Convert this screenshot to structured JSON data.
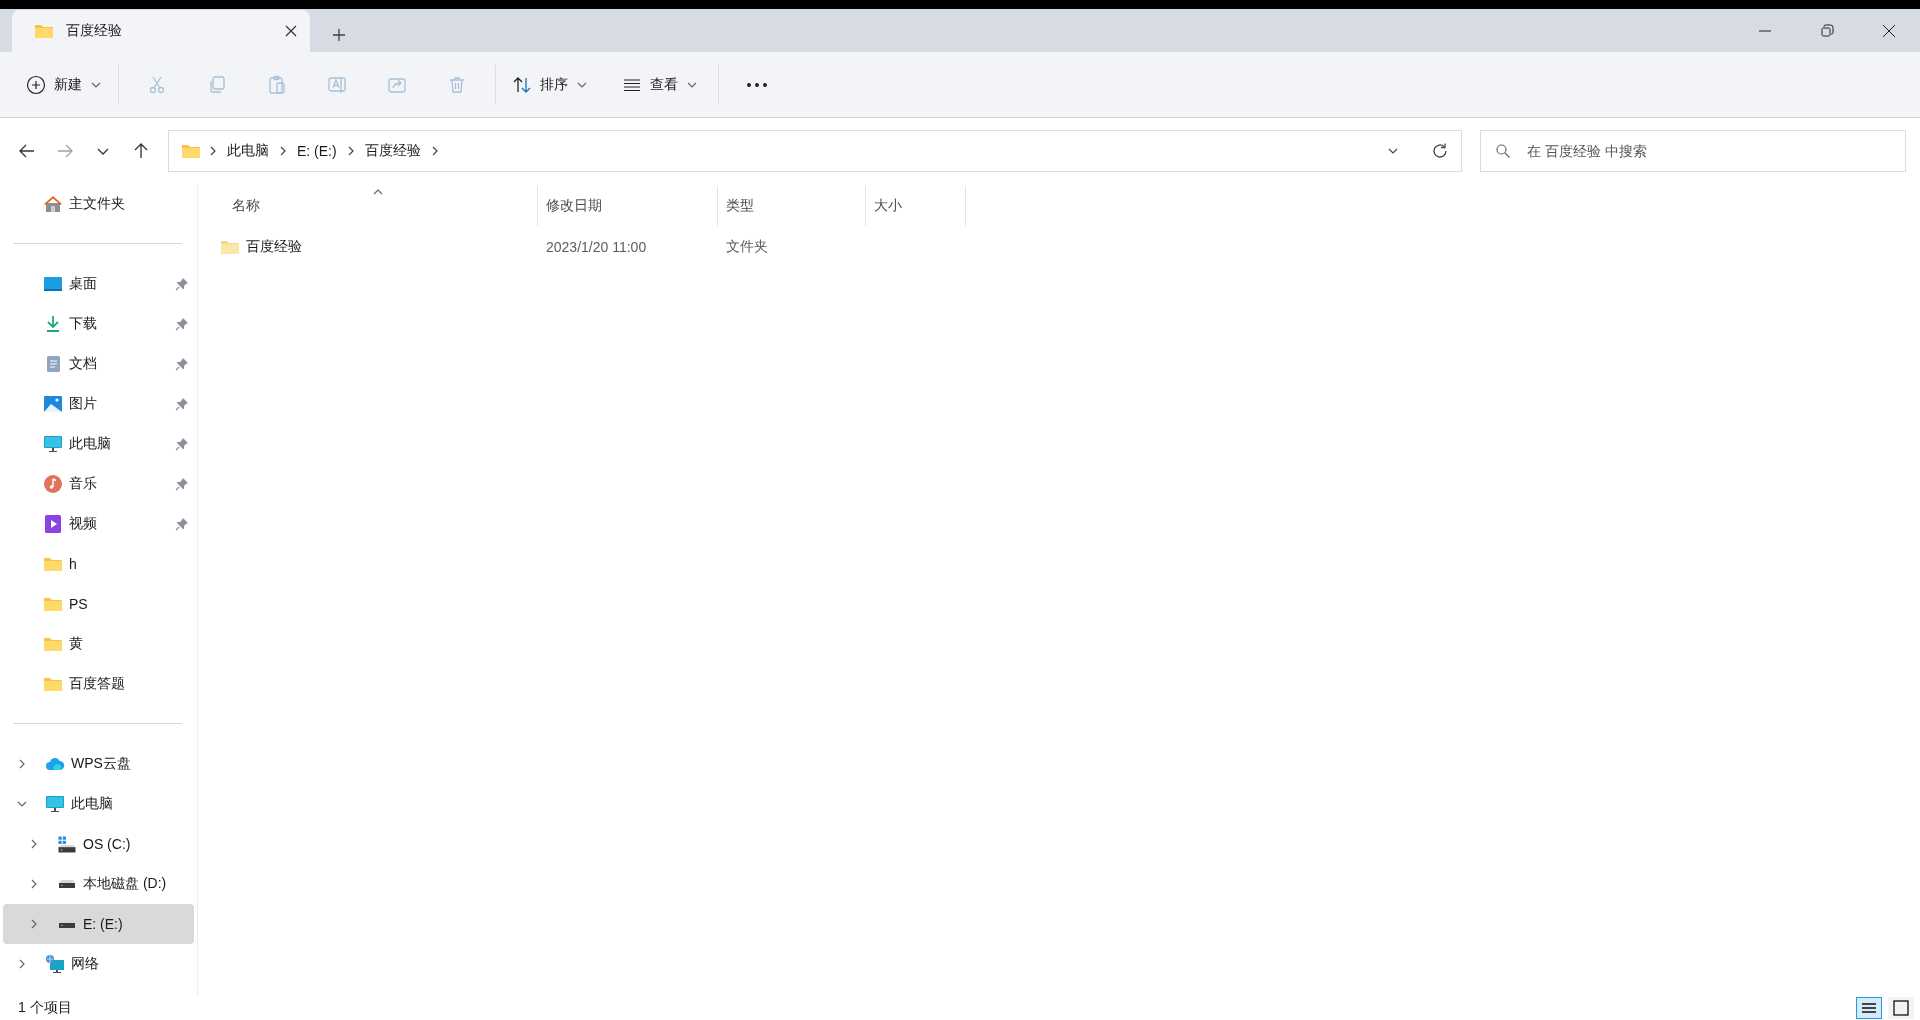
{
  "window": {
    "tabs": [
      {
        "title": "百度经验",
        "selected": true
      }
    ]
  },
  "toolbar": {
    "new_label": "新建",
    "actions": [
      {
        "kind": "cut",
        "disabled": true
      },
      {
        "kind": "copy",
        "disabled": true
      },
      {
        "kind": "paste",
        "disabled": true
      },
      {
        "kind": "rename",
        "disabled": true
      },
      {
        "kind": "share",
        "disabled": true
      },
      {
        "kind": "delete",
        "disabled": true
      }
    ],
    "sort_label": "排序",
    "view_label": "查看"
  },
  "navigation": {
    "buttons": [
      {
        "kind": "back",
        "disabled": false
      },
      {
        "kind": "forward",
        "disabled": true
      },
      {
        "kind": "recent",
        "disabled": false
      },
      {
        "kind": "up",
        "disabled": false
      }
    ],
    "breadcrumb": [
      "此电脑",
      "E: (E:)",
      "百度经验"
    ],
    "search": {
      "placeholder": "在 百度经验 中搜索"
    }
  },
  "sidebar": {
    "home": {
      "label": "主文件夹",
      "kind": "home"
    },
    "quick_access": [
      {
        "label": "桌面",
        "kind": "desktop",
        "pinned": true
      },
      {
        "label": "下载",
        "kind": "download",
        "pinned": true
      },
      {
        "label": "文档",
        "kind": "documents",
        "pinned": true
      },
      {
        "label": "图片",
        "kind": "pictures",
        "pinned": true
      },
      {
        "label": "此电脑",
        "kind": "pc",
        "pinned": true
      },
      {
        "label": "音乐",
        "kind": "music",
        "pinned": true
      },
      {
        "label": "视频",
        "kind": "video",
        "pinned": true
      },
      {
        "label": "h",
        "kind": "folder",
        "pinned": false
      },
      {
        "label": "PS",
        "kind": "folder",
        "pinned": false
      },
      {
        "label": "黄",
        "kind": "folder",
        "pinned": false
      },
      {
        "label": "百度答题",
        "kind": "folder",
        "pinned": false
      }
    ],
    "tree": [
      {
        "label": "WPS云盘",
        "kind": "cloud",
        "expanded": false,
        "selected": false
      },
      {
        "label": "此电脑",
        "kind": "pc",
        "expanded": true,
        "selected": false,
        "children": [
          {
            "label": "OS (C:)",
            "kind": "os-drive",
            "expanded": false,
            "selected": false
          },
          {
            "label": "本地磁盘 (D:)",
            "kind": "drive",
            "expanded": false,
            "selected": false
          },
          {
            "label": "E: (E:)",
            "kind": "drive",
            "expanded": false,
            "selected": true
          }
        ]
      },
      {
        "label": "网络",
        "kind": "network",
        "expanded": false,
        "selected": false
      }
    ]
  },
  "table": {
    "columns": [
      {
        "label": "名称",
        "sorted": true
      },
      {
        "label": "修改日期",
        "sorted": false
      },
      {
        "label": "类型",
        "sorted": false
      },
      {
        "label": "大小",
        "sorted": false
      }
    ],
    "rows": [
      {
        "name": "百度经验",
        "modified": "2023/1/20 11:00",
        "type": "文件夹"
      }
    ]
  },
  "status_bar": {
    "text": "1 个项目",
    "views": [
      {
        "kind": "details",
        "selected": true
      },
      {
        "kind": "tiles",
        "selected": false
      }
    ]
  }
}
